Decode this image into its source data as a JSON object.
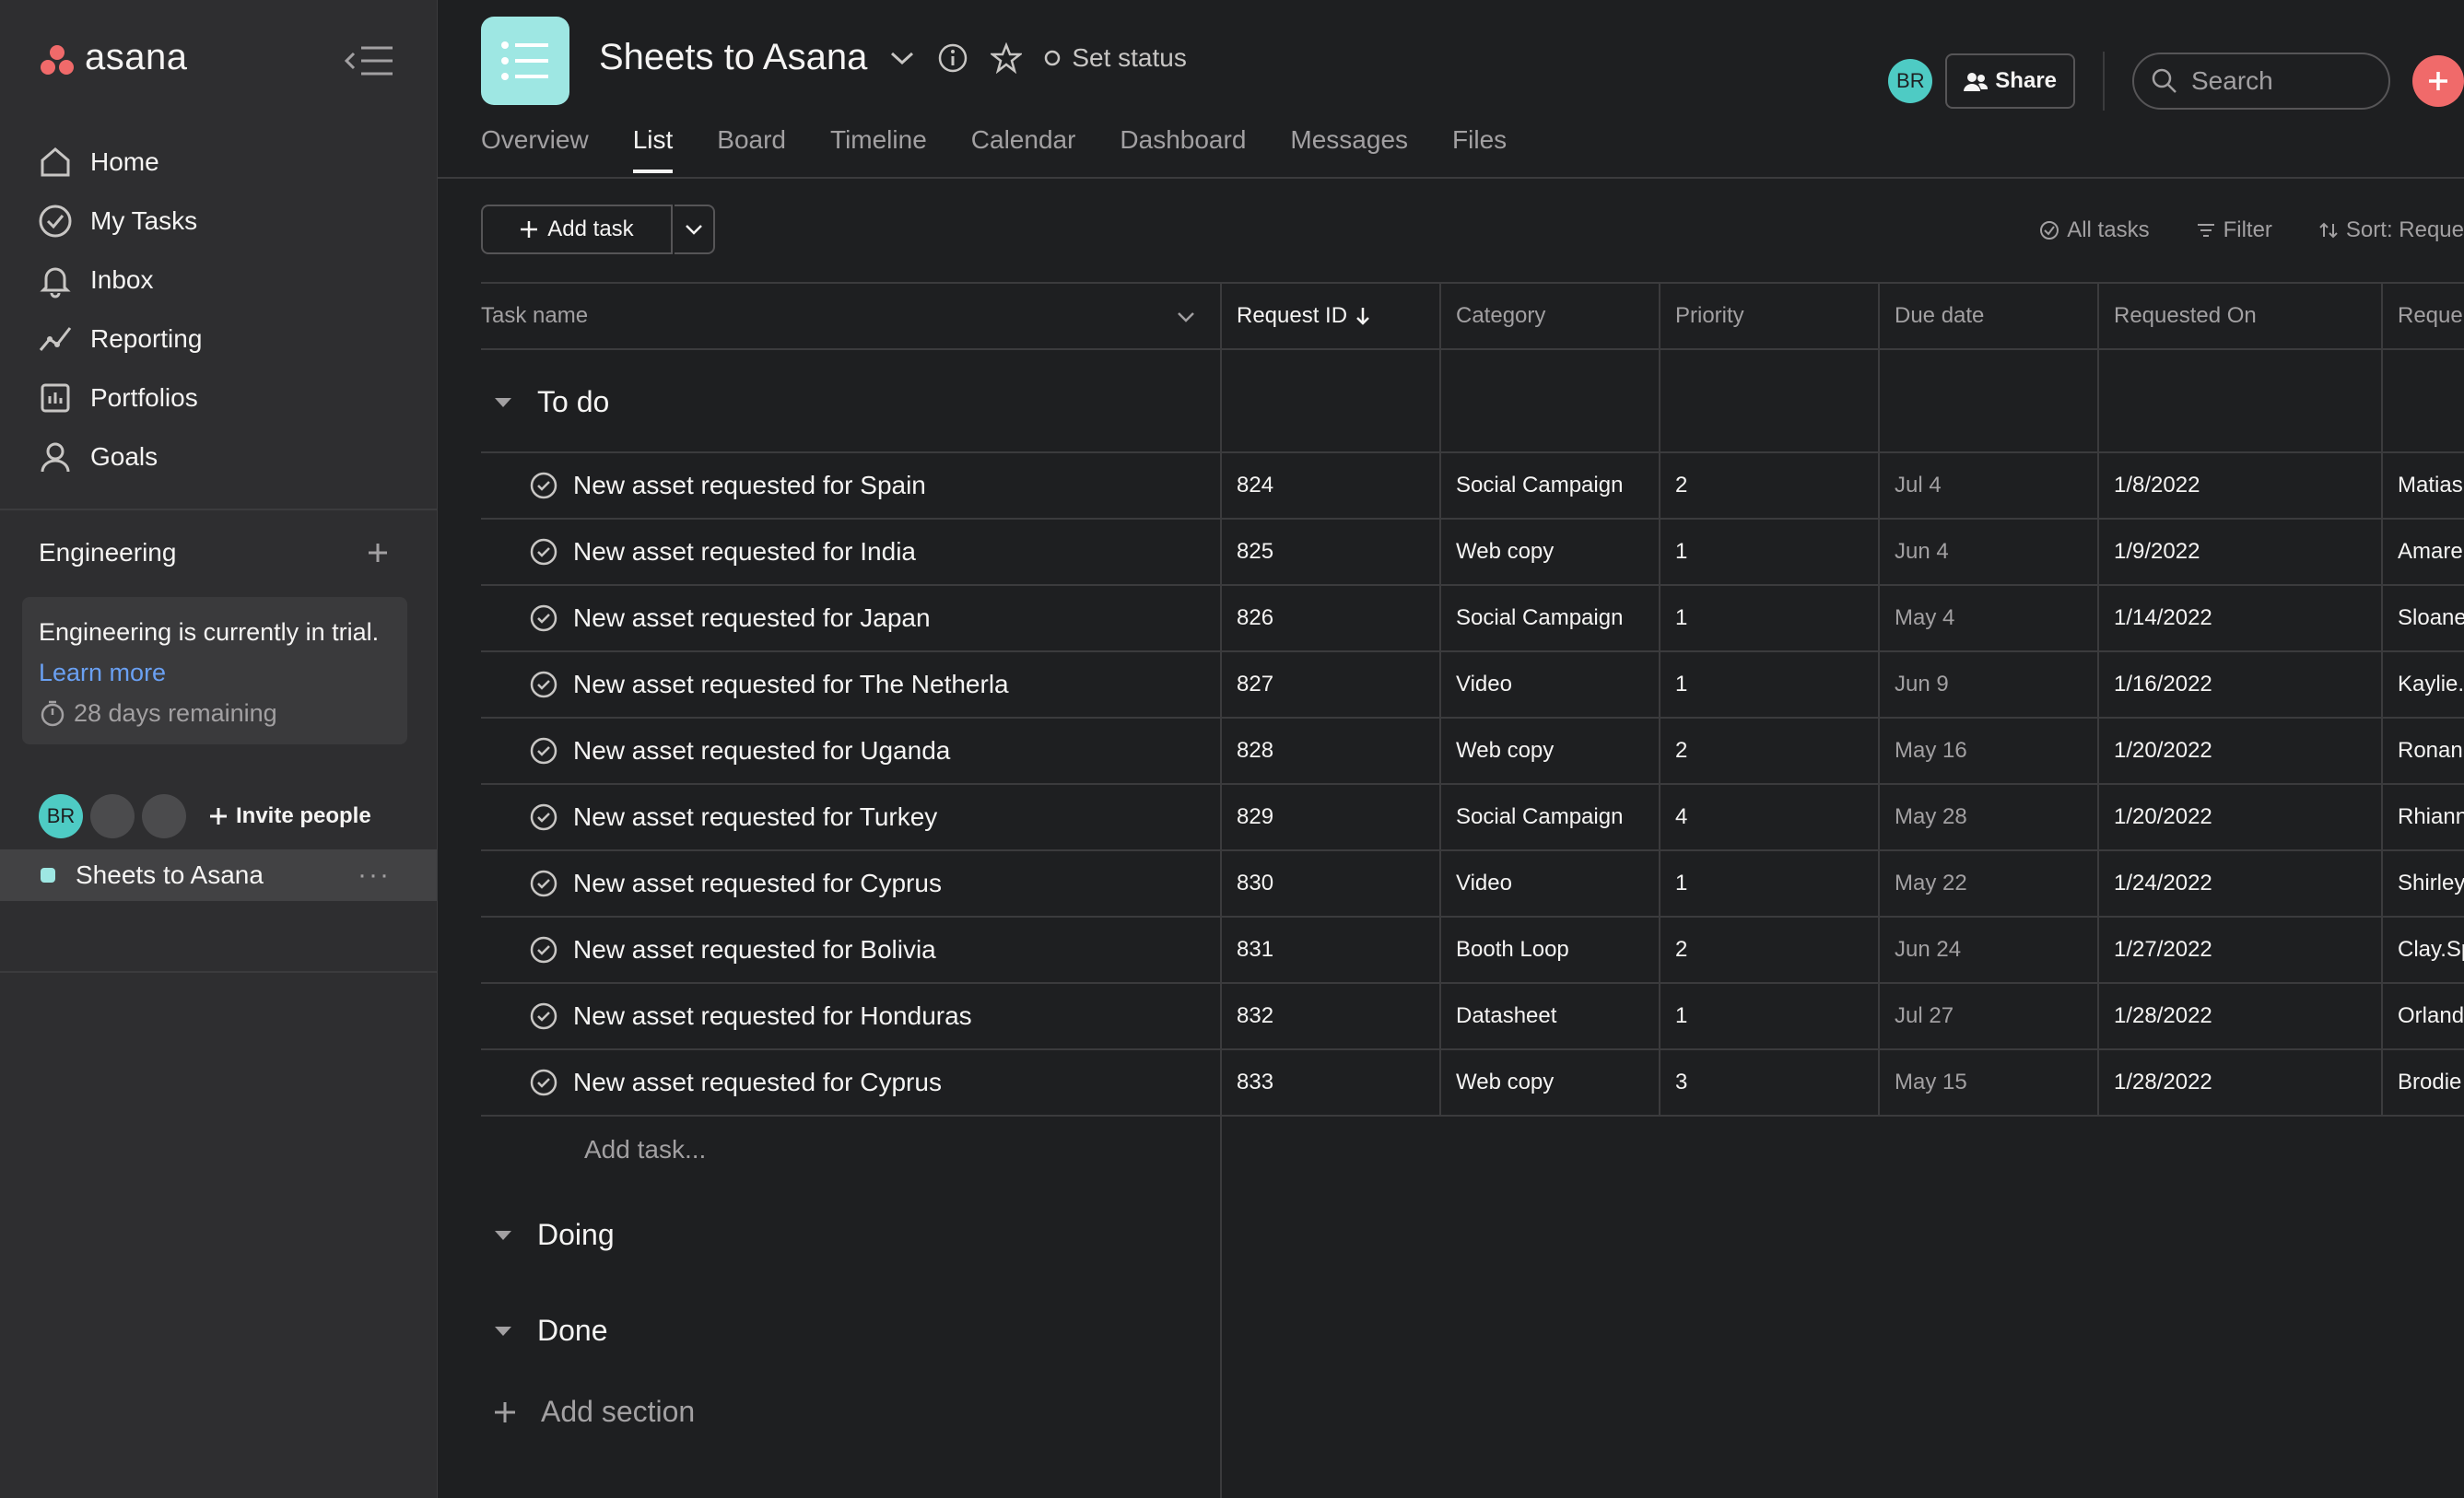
{
  "sidebar": {
    "logo_text": "asana",
    "nav": [
      {
        "label": "Home",
        "icon": "home-icon"
      },
      {
        "label": "My Tasks",
        "icon": "check-circle-icon"
      },
      {
        "label": "Inbox",
        "icon": "bell-icon"
      },
      {
        "label": "Reporting",
        "icon": "chart-line-icon"
      },
      {
        "label": "Portfolios",
        "icon": "portfolio-icon"
      },
      {
        "label": "Goals",
        "icon": "goals-icon"
      }
    ],
    "team": {
      "name": "Engineering",
      "trial_text": "Engineering is currently in trial.",
      "learn_more": "Learn more",
      "remaining": "28 days remaining"
    },
    "member_avatar": "BR",
    "invite_label": "Invite people",
    "project": {
      "name": "Sheets to Asana",
      "more": "···"
    }
  },
  "header": {
    "project_title": "Sheets to Asana",
    "set_status": "Set status",
    "avatar": "BR",
    "share_label": "Share",
    "search_placeholder": "Search",
    "tabs": [
      "Overview",
      "List",
      "Board",
      "Timeline",
      "Calendar",
      "Dashboard",
      "Messages",
      "Files"
    ],
    "active_tab": "List"
  },
  "toolbar": {
    "add_task": "Add task",
    "all_tasks": "All tasks",
    "filter": "Filter",
    "sort": "Sort: Reque"
  },
  "table": {
    "columns": [
      "Task name",
      "Request ID",
      "Category",
      "Priority",
      "Due date",
      "Requested On",
      "Reque"
    ],
    "sections": {
      "todo": "To do",
      "doing": "Doing",
      "done": "Done"
    },
    "rows": [
      {
        "name": "New asset requested for Spain",
        "id": "824",
        "category": "Social Campaign",
        "priority": "2",
        "due": "Jul 4",
        "requested_on": "1/8/2022",
        "requester": "Matias"
      },
      {
        "name": "New asset requested for India",
        "id": "825",
        "category": "Web copy",
        "priority": "1",
        "due": "Jun 4",
        "requested_on": "1/9/2022",
        "requester": "Amare"
      },
      {
        "name": "New asset requested for Japan",
        "id": "826",
        "category": "Social Campaign",
        "priority": "1",
        "due": "May 4",
        "requested_on": "1/14/2022",
        "requester": "Sloane"
      },
      {
        "name": "New asset requested for The Netherla",
        "id": "827",
        "category": "Video",
        "priority": "1",
        "due": "Jun 9",
        "requested_on": "1/16/2022",
        "requester": "Kaylie."
      },
      {
        "name": "New asset requested for Uganda",
        "id": "828",
        "category": "Web copy",
        "priority": "2",
        "due": "May 16",
        "requested_on": "1/20/2022",
        "requester": "Ronan."
      },
      {
        "name": "New asset requested for Turkey",
        "id": "829",
        "category": "Social Campaign",
        "priority": "4",
        "due": "May 28",
        "requested_on": "1/20/2022",
        "requester": "Rhiann"
      },
      {
        "name": "New asset requested for Cyprus",
        "id": "830",
        "category": "Video",
        "priority": "1",
        "due": "May 22",
        "requested_on": "1/24/2022",
        "requester": "Shirley"
      },
      {
        "name": "New asset requested for Bolivia",
        "id": "831",
        "category": "Booth Loop",
        "priority": "2",
        "due": "Jun 24",
        "requested_on": "1/27/2022",
        "requester": "Clay.Sp"
      },
      {
        "name": "New asset requested for Honduras",
        "id": "832",
        "category": "Datasheet",
        "priority": "1",
        "due": "Jul 27",
        "requested_on": "1/28/2022",
        "requester": "Orland"
      },
      {
        "name": "New asset requested for Cyprus",
        "id": "833",
        "category": "Web copy",
        "priority": "3",
        "due": "May 15",
        "requested_on": "1/28/2022",
        "requester": "Brodie"
      }
    ],
    "add_task_inline": "Add task...",
    "add_section": "Add section"
  }
}
